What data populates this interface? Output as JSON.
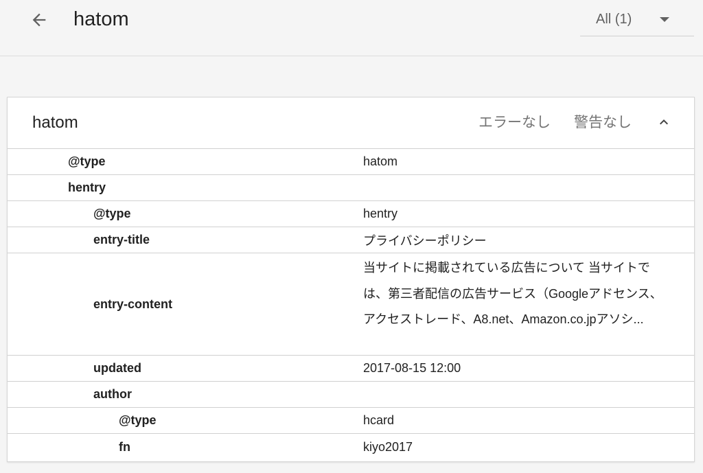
{
  "header": {
    "title": "hatom",
    "filter": {
      "selected": "All (1)"
    }
  },
  "card": {
    "title": "hatom",
    "errors_status": "エラーなし",
    "warnings_status": "警告なし",
    "rows": [
      {
        "key": "@type",
        "value": "hatom",
        "level": 0
      },
      {
        "key": "hentry",
        "value": "",
        "level": 0
      },
      {
        "key": "@type",
        "value": "hentry",
        "level": 1
      },
      {
        "key": "entry-title",
        "value": "プライバシーポリシー",
        "level": 1
      },
      {
        "key": "entry-content",
        "value": "当サイトに掲載されている広告について 当サイトでは、第三者配信の広告サービス（Googleアドセンス、アクセストレード、A8.net、Amazon.co.jpアソシ...",
        "level": 1
      },
      {
        "key": "updated",
        "value": "2017-08-15 12:00",
        "level": 1
      },
      {
        "key": "author",
        "value": "",
        "level": 1
      },
      {
        "key": "@type",
        "value": "hcard",
        "level": 2
      },
      {
        "key": "fn",
        "value": "kiyo2017",
        "level": 2
      }
    ]
  },
  "icons": {
    "back": "arrow-back-icon",
    "dropdown": "caret-down-icon",
    "collapse": "chevron-up-icon"
  },
  "colors": {
    "background": "#f5f5f5",
    "card": "#ffffff",
    "divider": "#d0d0d0",
    "text_primary": "#212121",
    "text_secondary": "#757575"
  }
}
